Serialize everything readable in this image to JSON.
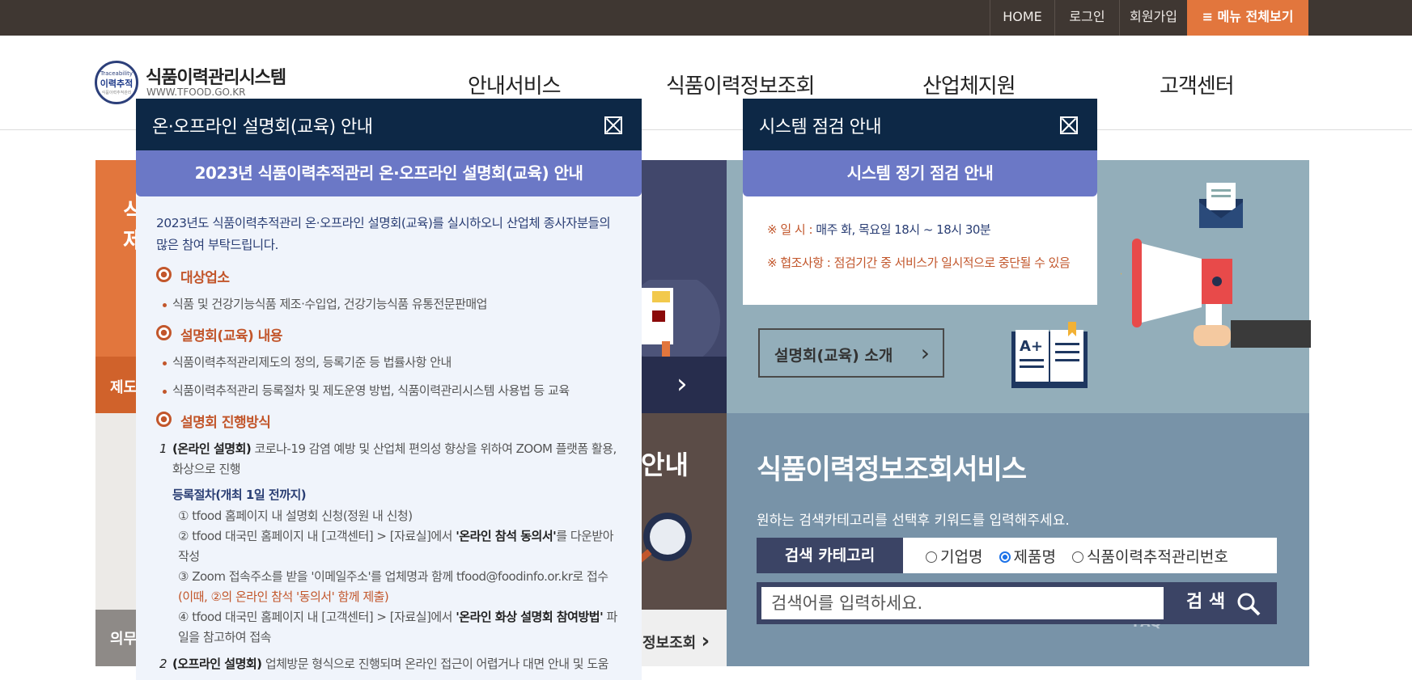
{
  "topbar": {
    "home": "HOME",
    "login": "로그인",
    "signup": "회원가입",
    "menu_all": "메뉴 전체보기",
    "menu_icon": "≡"
  },
  "header": {
    "logo_badge_top": "Traceability",
    "logo_badge_main": "이력추적",
    "logo_badge_bottom": "식품이력추적관리",
    "logo_title": "식품이력관리시스템",
    "logo_url": "WWW.TFOOD.GO.KR",
    "nav": [
      "안내서비스",
      "식품이력정보조회",
      "산업체지원",
      "고객센터"
    ]
  },
  "background": {
    "orange_text": "식\n제",
    "orange_bar_label": "제도",
    "grey_bottom_label": "의무",
    "brown_title": "안내",
    "brown_bottom_label": "정보조회",
    "intro_button": "설명회(교육) 소개",
    "faq_label": "FAQ",
    "service_title": "식품이력정보조회서비스",
    "service_desc": "원하는 검색카테고리를 선택후 키워드를 입력해주세요.",
    "search_category_label": "검색 카테고리",
    "search_options": [
      "기업명",
      "제품명",
      "식품이력추적관리번호"
    ],
    "search_selected": "제품명",
    "search_placeholder": "검색어를 입력하세요.",
    "search_button": "검 색"
  },
  "popup_education": {
    "title": "온·오프라인 설명회(교육) 안내",
    "band": "2023년 식품이력추적관리 온·오프라인 설명회(교육) 안내",
    "intro": "2023년도 식품이력추적관리 온·오프라인 설명회(교육)를 실시하오니 산업체 종사자분들의 많은 참여 부탁드립니다.",
    "sec1_title": "대상업소",
    "sec1_items": [
      "식품 및 건강기능식품 제조·수입업, 건강기능식품 유통전문판매업"
    ],
    "sec2_title": "설명회(교육) 내용",
    "sec2_items": [
      "식품이력추적관리제도의 정의, 등록기준 등 법률사항 안내",
      "식품이력추적관리 등록절차 및 제도운영 방법, 식품이력관리시스템 사용법 등 교육"
    ],
    "sec3_title": "설명회 진행방식",
    "online_num": "1",
    "online_label": "(온라인 설명회)",
    "online_text": " 코로나-19 감염 예방 및 산업체 편의성 향상을 위하여 ZOOM 플랫폼 활용, 화상으로 진행",
    "reg_title": "등록절차(개최 1일 전까지)",
    "step1": "① tfood 홈페이지 내 설명회 신청(정원 내 신청)",
    "step2_a": "② tfood 대국민 홈페이지 내 [고객센터] > [자료실]에서 ",
    "step2_b": "'온라인 참석 동의서'",
    "step2_c": "를 다운받아 작성",
    "step3_a": "③ Zoom 접속주소를 받을 '이메일주소'를 업체명과 함께 tfood@foodinfo.or.kr로 접수",
    "step3_note": "(이때, ②의 온라인 참석 '동의서' 함께 제출)",
    "step4_a": "④ tfood 대국민 홈페이지 내 [고객센터] > [자료실]에서 ",
    "step4_b": "'온라인 화상 설명회 참여방법'",
    "step4_c": " 파일을 참고하여 접속",
    "offline_num": "2",
    "offline_label": "(오프라인 설명회)",
    "offline_text": " 업체방문 형식으로 진행되며 온라인 접근이 어렵거나 대면 안내 및 도움"
  },
  "popup_system": {
    "title": "시스템 점검 안내",
    "band": "시스템 정기 점검 안내",
    "row1_label": "※ 일 시 : ",
    "row1_value": "매주 화, 목요일 18시 ~ 18시 30분",
    "row2_label": "※ 협조사항 : ",
    "row2_value": "점검기간 중 서비스가 일시적으로 중단될 수 있음"
  }
}
